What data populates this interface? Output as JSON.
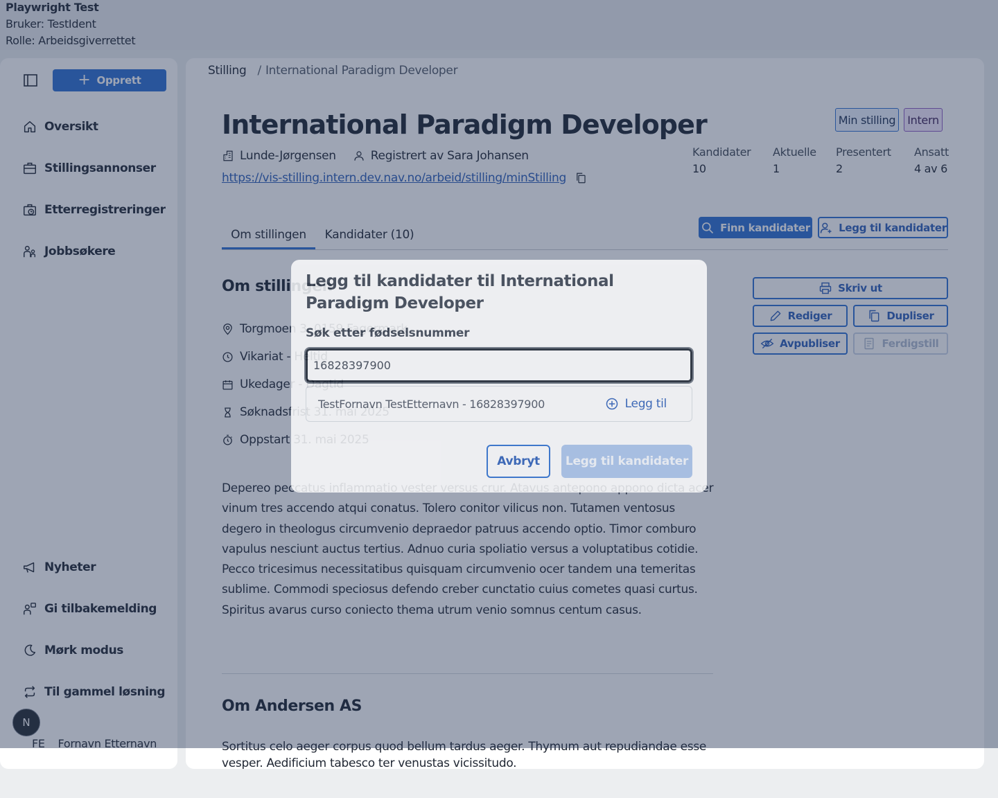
{
  "top_info": {
    "title": "Playwright Test",
    "user": "Bruker: TestIdent",
    "role": "Rolle: Arbeidsgiverrettet"
  },
  "sidebar": {
    "create_label": "Opprett",
    "nav_items": [
      {
        "label": "Oversikt",
        "icon": "home-icon"
      },
      {
        "label": "Stillingsannonser",
        "icon": "briefcase-icon"
      },
      {
        "label": "Etterregistreringer",
        "icon": "briefcase-clock-icon"
      },
      {
        "label": "Jobbsøkere",
        "icon": "people-icon"
      }
    ],
    "bottom_items": [
      {
        "label": "Nyheter",
        "icon": "megaphone-icon"
      },
      {
        "label": "Gi tilbakemelding",
        "icon": "person-chat-icon"
      },
      {
        "label": "Mørk modus",
        "icon": "moon-icon"
      },
      {
        "label": "Til gammel løsning",
        "icon": "arrows-circle-icon"
      }
    ],
    "avatar_letter": "N",
    "user_initials": "FE",
    "user_name": "Fornavn Etternavn"
  },
  "breadcrumb": {
    "root": "Stilling",
    "separator": "/",
    "current": "International Paradigm Developer"
  },
  "job": {
    "title": "International Paradigm Developer",
    "tags": [
      "Min stilling",
      "Intern"
    ],
    "employer": "Lunde-Jørgensen",
    "registered_by": "Registrert av Sara Johansen",
    "url": "https://vis-stilling.intern.dev.nav.no/arbeid/stilling/minStilling"
  },
  "stats": [
    {
      "label": "Kandidater",
      "value": "10"
    },
    {
      "label": "Aktuelle",
      "value": "1"
    },
    {
      "label": "Presentert",
      "value": "2"
    },
    {
      "label": "Ansatt",
      "value": "4 av 6"
    }
  ],
  "tabs": [
    {
      "label": "Om stillingen",
      "active": true
    },
    {
      "label": "Kandidater (10)",
      "active": false
    }
  ],
  "actions": {
    "find_candidates": "Finn kandidater",
    "add_candidates": "Legg til kandidater",
    "print": "Skriv ut",
    "edit": "Rediger",
    "duplicate": "Dupliser",
    "unpublish": "Avpubliser",
    "complete": "Ferdigstill"
  },
  "about": {
    "heading": "Om stillingen",
    "rows": [
      {
        "label": "Torgmoen 3, 0159 Fagermark",
        "icon": "location-pin-icon"
      },
      {
        "label": "Vikariat - Heltid",
        "icon": "clock-icon"
      },
      {
        "label": "Ukedager - Dagtid",
        "icon": "calendar-icon"
      },
      {
        "label": "Søknadsfrist 31. mai 2025",
        "icon": "hourglass-icon"
      },
      {
        "label": "Oppstart 31. mai 2025",
        "icon": "stopwatch-icon"
      }
    ],
    "description": "Depereo peccatus inflammatio vester versus crur. Atavus antepono appono dicta acer vinum tres accendo atqui conatus. Tolero conitor vilicus non. Tutamen ventosus degero in theologus circumvenio depraedor patruus accendo optio. Timor comburo vapulus nesciunt auctus tertius. Adnuo curia spoliatio versus a voluptatibus cotidie. Pecco tricesimus necessitatibus quisquam circumvenio ocer tandem una temeritas sublime. Commodi speciosus defendo creber cunctatio cuius cometes quasi curtus. Spiritus avarus curso coniecto thema utrum venio somnus centum casus."
  },
  "employer_section": {
    "heading": "Om Andersen AS",
    "text": "Sortitus celo aeger corpus quod bellum tardus aeger. Thymum aut repudiandae esse vesper. Aedificium tabesco ter venustas vicissitudo."
  },
  "modal": {
    "title": "Legg til kandidater til International Paradigm Developer",
    "search_label": "Søk etter fødselsnummer",
    "search_value": "16828397900",
    "result_text": "TestFornavn TestEtternavn - 16828397900",
    "result_action": "Legg til",
    "cancel_label": "Avbryt",
    "submit_label": "Legg til kandidater"
  }
}
